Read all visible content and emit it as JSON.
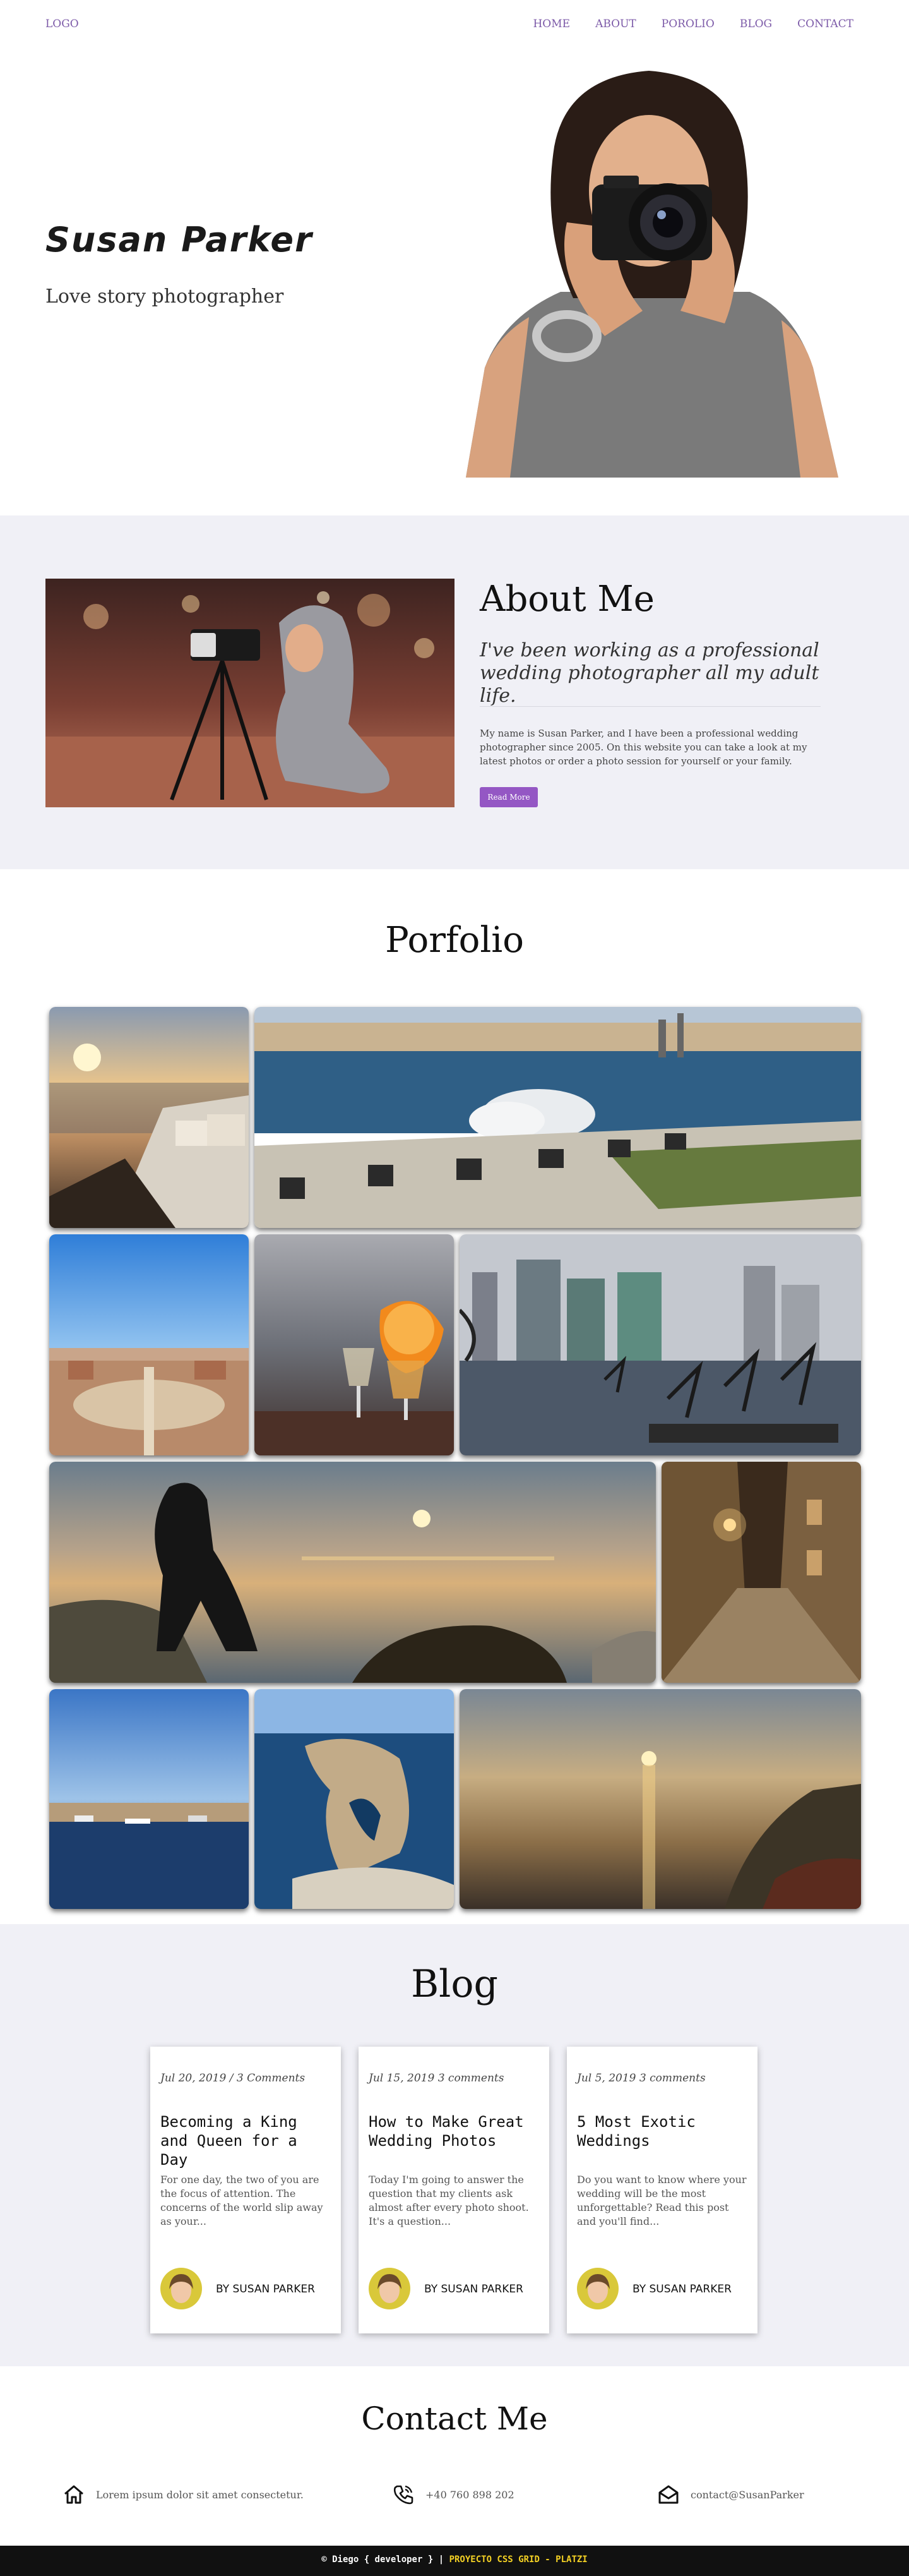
{
  "nav": {
    "logo": "LOGO",
    "items": [
      "HOME",
      "ABOUT",
      "POROLIO",
      "BLOG",
      "CONTACT"
    ]
  },
  "hero": {
    "name": "Susan Parker",
    "subtitle": "Love story photographer"
  },
  "about": {
    "title": "About Me",
    "lead": "I've been working as a professional wedding photographer all my adult life.",
    "body": "My name is Susan Parker, and I have been a professional wedding photographer since 2005. On this website you can take a look at my latest photos or order a photo session for yourself or your family.",
    "button": "Read More"
  },
  "portfolio": {
    "title": "Porfolio"
  },
  "blog": {
    "title": "Blog",
    "posts": [
      {
        "date": "Jul 20, 2019 / 3 Comments",
        "title": "Becoming a King and Queen for a Day",
        "excerpt": "For one day, the two of you are the focus of attention. The concerns of the world slip away as your...",
        "author": "BY SUSAN PARKER"
      },
      {
        "date": "Jul 15, 2019 3 comments",
        "title": "How to Make Great Wedding Photos",
        "excerpt": "Today I'm going to answer the question that my clients ask almost after every photo shoot. It's a question...",
        "author": "BY SUSAN PARKER"
      },
      {
        "date": "Jul 5, 2019 3 comments",
        "title": "5 Most Exotic Weddings",
        "excerpt": "Do you want to know where your wedding will be the most unforgettable? Read this post and you'll find...",
        "author": "BY SUSAN PARKER"
      }
    ]
  },
  "contact": {
    "title": "Contact Me",
    "address": "Lorem ipsum dolor sit amet consectetur.",
    "phone": "+40 760 898 202",
    "email": "contact@SusanParker"
  },
  "footer": {
    "prefix": "© Diego { developer } |",
    "highlight": "PROYECTO CSS GRID - PLATZI"
  },
  "colors": {
    "accent": "#9457c4",
    "nav": "#7c5aa8",
    "section_bg": "#f0f0f6",
    "footer_bg": "#111111",
    "footer_highlight": "#f3d023"
  }
}
